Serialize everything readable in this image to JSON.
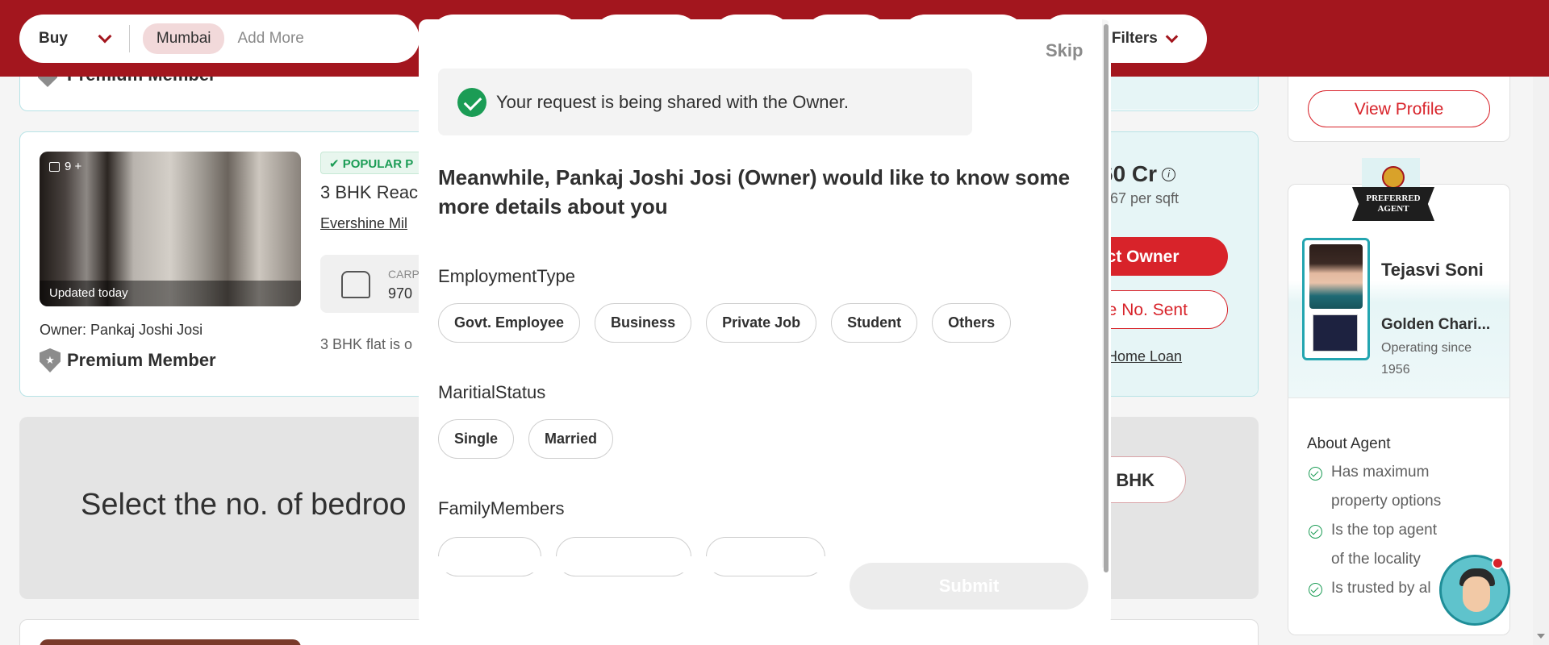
{
  "header": {
    "buy_label": "Buy",
    "city_chip": "Mumbai",
    "add_more": "Add More",
    "more_filters": "e Filters"
  },
  "listing_prev": {
    "premium": "Premium Member"
  },
  "listing": {
    "photo_count": "9 +",
    "updated": "Updated today",
    "popular_tag": "POPULAR P",
    "title": "3 BHK Reac",
    "project": "Evershine Mil",
    "carpet_label": "CARP",
    "carpet_value": "970",
    "description": "3 BHK flat is o",
    "owner": "Owner: Pankaj Joshi Josi",
    "premium": "Premium Member",
    "price": "60 Cr",
    "per_sqft": "67 per sqft",
    "contact_btn": "act Owner",
    "phone_btn": "ne No. Sent",
    "home_loan": "Home Loan"
  },
  "bhk_banner": {
    "title": "Select the no. of bedroo",
    "chip": "5 BHK"
  },
  "sidebar": {
    "view_profile": "View Profile",
    "badge_text": "PREFERRED AGENT",
    "agent_name": "Tejasvi Soni",
    "agency": "Golden Chari...",
    "operating": "Operating since 1956",
    "about_title": "About Agent",
    "about_items": [
      "Has maximum property options",
      "Is the top agent of the locality",
      "Is trusted by al"
    ]
  },
  "modal": {
    "skip": "Skip",
    "notice": "Your request is being shared with the Owner.",
    "question": "Meanwhile, Pankaj Joshi Josi (Owner) would like to know some more details about you",
    "employment_label": "EmploymentType",
    "employment_options": [
      "Govt. Employee",
      "Business",
      "Private Job",
      "Student",
      "Others"
    ],
    "marital_label": "MaritialStatus",
    "marital_options": [
      "Single",
      "Married"
    ],
    "family_label": "FamilyMembers",
    "submit": "Submit"
  },
  "colors": {
    "brand_red": "#a3161e",
    "accent_red": "#d8232a",
    "success_green": "#1b9c55",
    "teal": "#23a5b0"
  }
}
